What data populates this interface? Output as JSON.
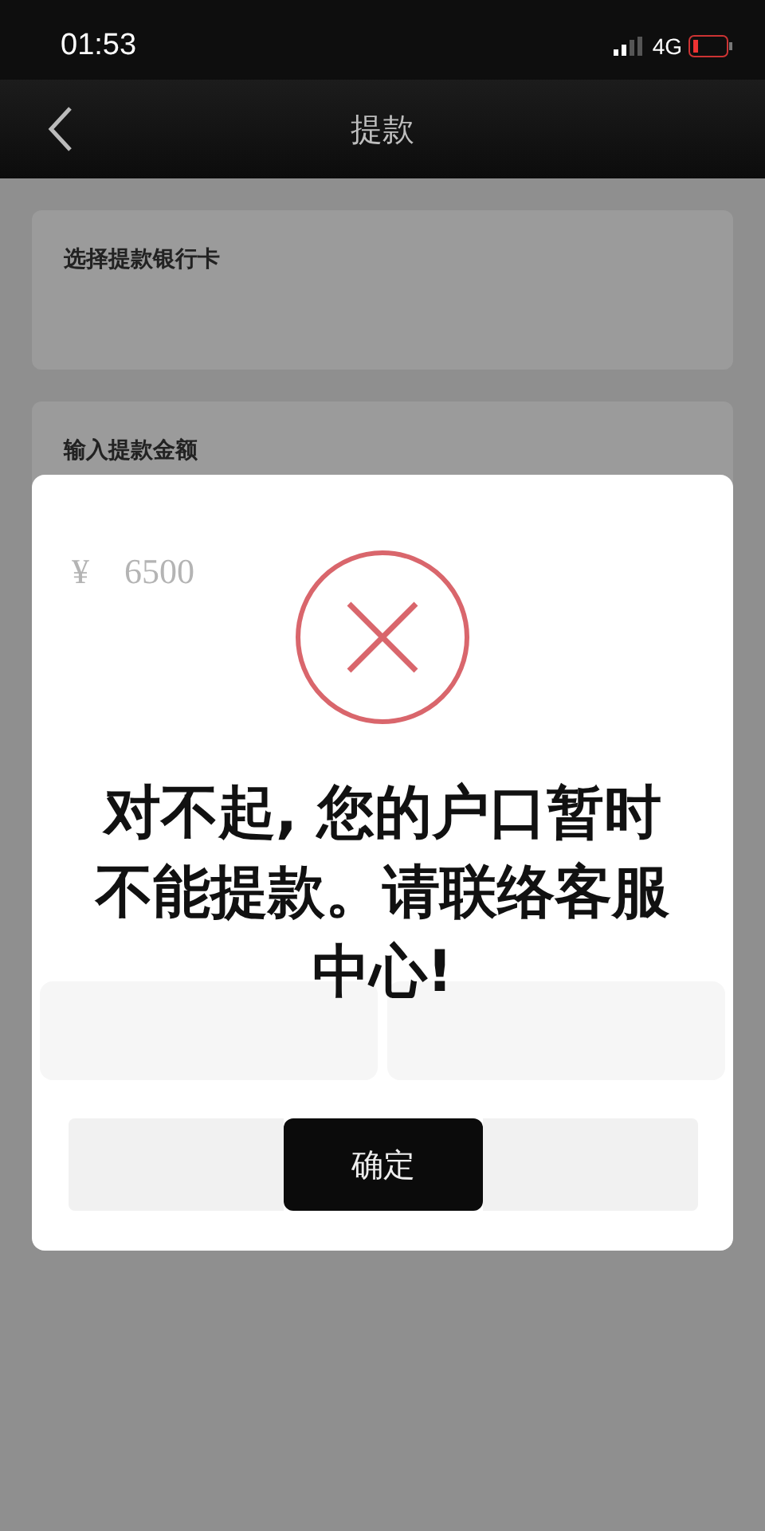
{
  "status_bar": {
    "time": "01:53",
    "network": "4G"
  },
  "nav": {
    "title": "提款"
  },
  "page": {
    "bank_card_label": "选择提款银行卡",
    "amount_label": "输入提款金额"
  },
  "dialog": {
    "kind": "error",
    "currency": "¥",
    "amount": "6500",
    "message": "对不起, 您的户口暂时不能提款。请联络客服中心!",
    "button": "确定"
  }
}
